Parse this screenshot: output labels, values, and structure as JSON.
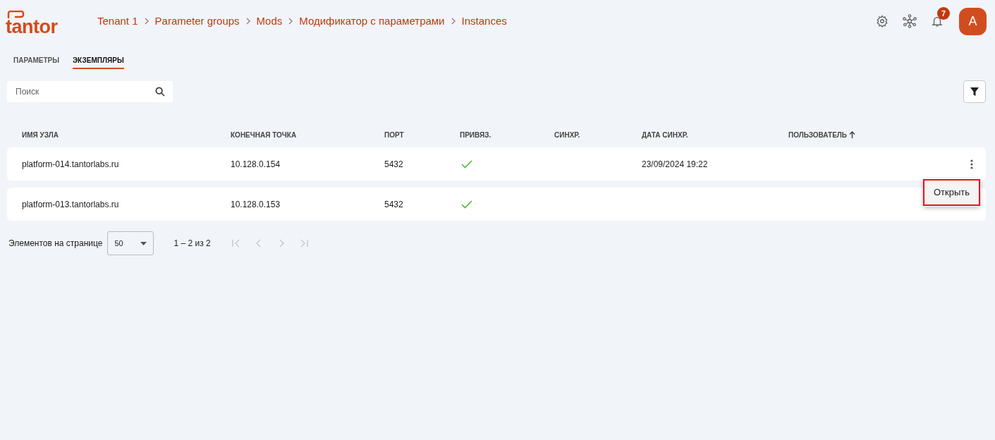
{
  "header": {
    "logo": "tantor",
    "breadcrumbs": [
      "Tenant 1",
      "Parameter groups",
      "Mods",
      "Модификатор с параметрами",
      "Instances"
    ],
    "notifications_badge": "7",
    "avatar": "A"
  },
  "tabs": [
    {
      "label": "ПАРАМЕТРЫ",
      "selected": false
    },
    {
      "label": "ЭКЗЕМПЛЯРЫ",
      "selected": true
    }
  ],
  "search": {
    "placeholder": "Поиск"
  },
  "table": {
    "columns": [
      {
        "label": "ИМЯ УЗЛА",
        "sorted": false
      },
      {
        "label": "КОНЕЧНАЯ ТОЧКА",
        "sorted": false
      },
      {
        "label": "ПОРТ",
        "sorted": false
      },
      {
        "label": "ПРИВЯЗ.",
        "sorted": false
      },
      {
        "label": "СИНХР.",
        "sorted": false
      },
      {
        "label": "ДАТА СИНХР.",
        "sorted": false
      },
      {
        "label": "ПОЛЬЗОВАТЕЛЬ",
        "sorted": true
      }
    ],
    "rows": [
      {
        "host": "platform-014.tantorlabs.ru",
        "endpoint": "10.128.0.154",
        "port": "5432",
        "bound": true,
        "sync_date": "23/09/2024 19:22",
        "menu_button": true
      },
      {
        "host": "platform-013.tantorlabs.ru",
        "endpoint": "10.128.0.153",
        "port": "5432",
        "bound": true,
        "menu_button": false
      }
    ]
  },
  "context_menu": {
    "items": [
      {
        "label": "Открыть",
        "highlighted": true
      }
    ]
  },
  "pagination": {
    "label": "Элементов на странице",
    "page_size": "50",
    "range": "1 – 2 из 2",
    "first_disabled": true,
    "prev_disabled": true,
    "next_disabled": true,
    "last_disabled": true
  }
}
